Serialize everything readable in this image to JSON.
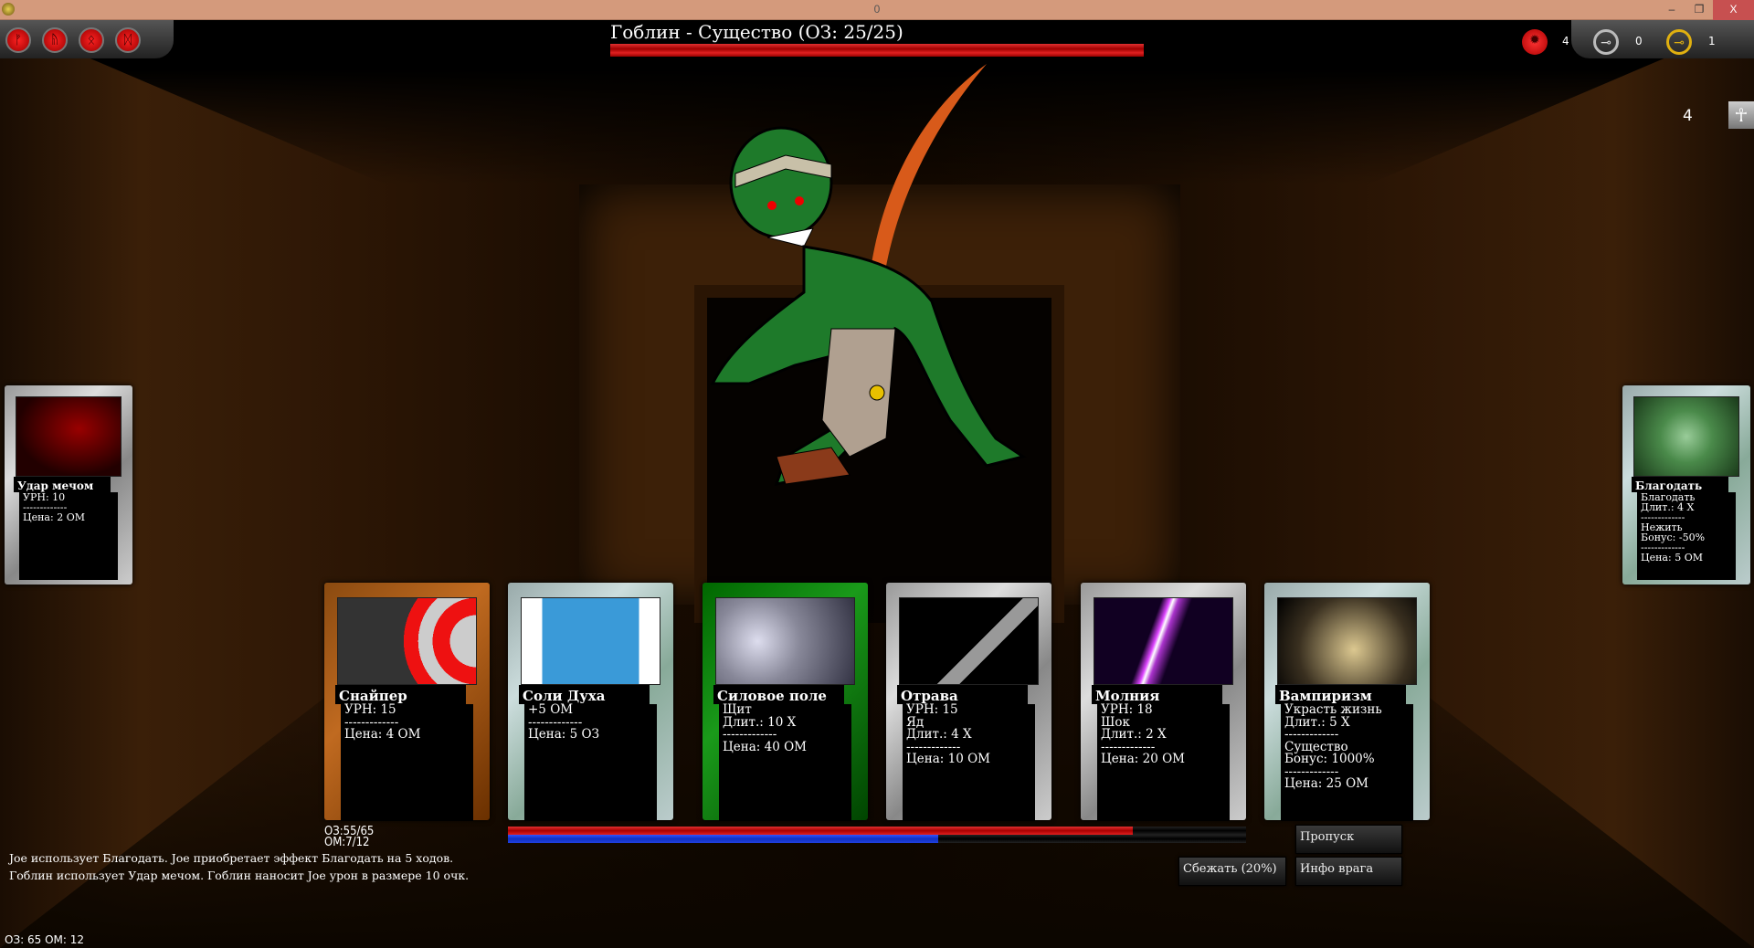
{
  "window": {
    "title": "0",
    "minimize": "–",
    "restore": "❐",
    "close": "X"
  },
  "enemy": {
    "label": "Гоблин - Существо (ОЗ: 25/25)",
    "hp": 25,
    "hp_max": 25
  },
  "menu_icons": [
    {
      "icon": "rune-1-icon",
      "glyph": "ᚠ"
    },
    {
      "icon": "rune-2-icon",
      "glyph": "ᚥ"
    },
    {
      "icon": "rune-3-icon",
      "glyph": "ᛟ"
    },
    {
      "icon": "rune-4-icon",
      "glyph": "ᛞ"
    }
  ],
  "resources": [
    {
      "icon": "red-gem-icon",
      "count": "4",
      "color": "#e01010"
    },
    {
      "icon": "silver-key-icon",
      "count": "0",
      "color": "#b0b0b0"
    },
    {
      "icon": "gold-key-icon",
      "count": "1",
      "color": "#e0b010"
    }
  ],
  "floor": {
    "number": "4",
    "icon": "ankh-icon"
  },
  "cards": [
    {
      "name": "Снайпер",
      "text": "УРН: 15\n-------------\nЦена: 4 ОМ",
      "frame": "wood",
      "image": "target-arrow"
    },
    {
      "name": "Соли Духа",
      "text": "+5 ОМ\n-------------\nЦена: 5 ОЗ",
      "frame": "metal",
      "image": "blue-bottle"
    },
    {
      "name": "Силовое поле",
      "text": "Щит\nДлит.: 10 Х\n-------------\nЦена: 40 ОМ",
      "frame": "green",
      "image": "force-field"
    },
    {
      "name": "Отрава",
      "text": "УРН: 15\nЯд\nДлит.: 4 Х\n-------------\nЦена: 10 ОМ",
      "frame": "silver",
      "image": "poison-blade"
    },
    {
      "name": "Молния",
      "text": "УРН: 18\nШок\nДлит.: 2 Х\n-------------\nЦена: 20 ОМ",
      "frame": "silver",
      "image": "lightning"
    },
    {
      "name": "Вампиризм",
      "text": "Украсть жизнь\nДлит.: 5 Х\n-------------\nСущество\nБонус: 1000%\n-------------\nЦена: 25 ОМ",
      "frame": "metal",
      "image": "vampire"
    }
  ],
  "enemy_card": {
    "name": "Удар мечом",
    "text": "УРН: 10\n-------------\nЦена: 2 ОМ"
  },
  "player_effect_card": {
    "name": "Благодать",
    "text": "Благодать\nДлит.: 4 Х\n-------------\nНежить\nБонус: -50%\n-------------\nЦена: 5 ОМ"
  },
  "player": {
    "hp_label": "ОЗ:55/65",
    "mp_label": "ОМ:7/12",
    "hp": 55,
    "hp_max": 65,
    "mp": 7,
    "mp_max": 12,
    "bottom_status": "ОЗ: 65 ОМ: 12"
  },
  "buttons": {
    "skip": "Пропуск",
    "flee": "Сбежать (20%)",
    "enemy_info": "Инфо врага"
  },
  "log": [
    "Joe использует Благодать.  Joe приобретает эффект Благодать на 5 ходов.",
    "Гоблин использует Удар мечом. Гоблин наносит Joe урон в размере 10 очк."
  ]
}
